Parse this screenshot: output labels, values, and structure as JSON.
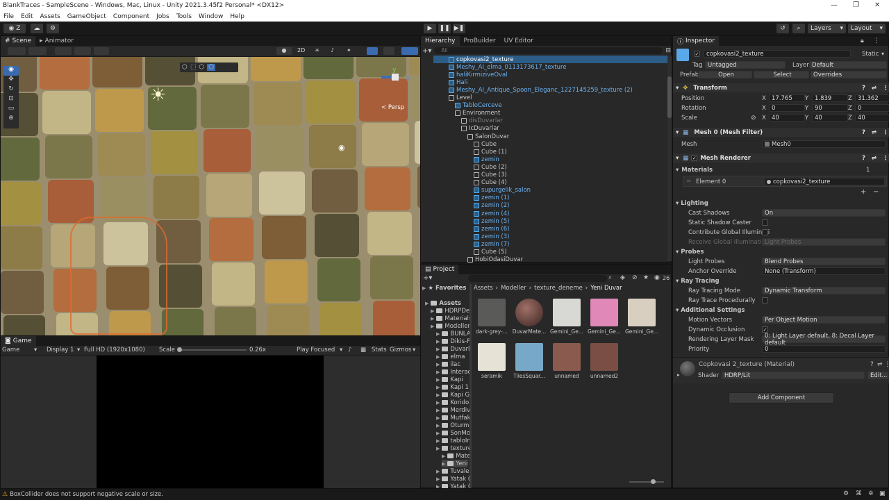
{
  "window": {
    "title": "BlankTraces - SampleScene - Windows, Mac, Linux - Unity 2021.3.45f2 Personal* <DX12>"
  },
  "menu": [
    "File",
    "Edit",
    "Assets",
    "GameObject",
    "Component",
    "Jobs",
    "Tools",
    "Window",
    "Help"
  ],
  "toolbar": {
    "account_label": "Z",
    "layers_label": "Layers",
    "layout_label": "Layout"
  },
  "scene_panel": {
    "tabs": [
      "Scene",
      "Animator"
    ],
    "mode_2d": "2D",
    "persp_label": "< Persp",
    "gizmo_y": "y",
    "gizmo_z": "z"
  },
  "game_panel": {
    "tab": "Game",
    "mode": "Game",
    "display": "Display 1",
    "resolution": "Full HD (1920x1080)",
    "scale_label": "Scale",
    "scale_value": "0.26x",
    "play_focused": "Play Focused",
    "stats": "Stats",
    "gizmos": "Gizmos"
  },
  "hierarchy": {
    "tabs": [
      "Hierarchy",
      "ProBuilder",
      "UV Editor"
    ],
    "search_placeholder": "All",
    "items": [
      {
        "label": "copkovasi2_texture",
        "indent": 0,
        "style": "selected",
        "icon": "blue"
      },
      {
        "label": "Meshy_AI_elma_0113173617_texture",
        "indent": 0,
        "style": "blue",
        "icon": "blue"
      },
      {
        "label": "haliKirmiziveOval",
        "indent": 0,
        "style": "blue",
        "icon": "blue"
      },
      {
        "label": "Hali",
        "indent": 0,
        "style": "blue",
        "icon": "blue"
      },
      {
        "label": "Meshy_AI_Antique_Spoon_Eleganc_1227145259_texture (2)",
        "indent": 0,
        "style": "blue",
        "icon": "blue"
      },
      {
        "label": "Level",
        "indent": 0,
        "style": "normal",
        "icon": "grey"
      },
      {
        "label": "TabloCerceve",
        "indent": 1,
        "style": "blue",
        "icon": "blue"
      },
      {
        "label": "Environment",
        "indent": 1,
        "style": "normal",
        "icon": "grey"
      },
      {
        "label": "disDuvarlar",
        "indent": 2,
        "style": "dim",
        "icon": "grey"
      },
      {
        "label": "IcDuvarlar",
        "indent": 2,
        "style": "normal",
        "icon": "grey"
      },
      {
        "label": "SalonDuvar",
        "indent": 3,
        "style": "normal",
        "icon": "grey"
      },
      {
        "label": "Cube",
        "indent": 4,
        "style": "normal",
        "icon": "grey"
      },
      {
        "label": "Cube (1)",
        "indent": 4,
        "style": "normal",
        "icon": "grey"
      },
      {
        "label": "zemin",
        "indent": 4,
        "style": "blue",
        "icon": "blue"
      },
      {
        "label": "Cube (2)",
        "indent": 4,
        "style": "normal",
        "icon": "grey"
      },
      {
        "label": "Cube (3)",
        "indent": 4,
        "style": "normal",
        "icon": "grey"
      },
      {
        "label": "Cube (4)",
        "indent": 4,
        "style": "normal",
        "icon": "grey"
      },
      {
        "label": "supurgelik_salon",
        "indent": 4,
        "style": "blue",
        "icon": "blue"
      },
      {
        "label": "zemin (1)",
        "indent": 4,
        "style": "blue",
        "icon": "blue"
      },
      {
        "label": "zemin (2)",
        "indent": 4,
        "style": "blue",
        "icon": "blue"
      },
      {
        "label": "zemin (4)",
        "indent": 4,
        "style": "blue",
        "icon": "blue"
      },
      {
        "label": "zemin (5)",
        "indent": 4,
        "style": "blue",
        "icon": "blue"
      },
      {
        "label": "zemin (6)",
        "indent": 4,
        "style": "blue",
        "icon": "blue"
      },
      {
        "label": "zemin (3)",
        "indent": 4,
        "style": "blue",
        "icon": "blue"
      },
      {
        "label": "zemin (7)",
        "indent": 4,
        "style": "blue",
        "icon": "blue"
      },
      {
        "label": "Cube (5)",
        "indent": 4,
        "style": "normal",
        "icon": "grey"
      },
      {
        "label": "HobiOdasiDuvar",
        "indent": 3,
        "style": "normal",
        "icon": "grey"
      }
    ]
  },
  "project": {
    "tab": "Project",
    "count": "26",
    "favorites": "Favorites",
    "breadcrumb": [
      "Assets",
      "Modeller",
      "texture_deneme",
      "Yeni Duvar"
    ],
    "tree": [
      {
        "label": "Assets",
        "indent": 0,
        "bold": true
      },
      {
        "label": "HDRPDef",
        "indent": 1
      },
      {
        "label": "Materials",
        "indent": 1
      },
      {
        "label": "Modeller",
        "indent": 1
      },
      {
        "label": "BUNLA",
        "indent": 2
      },
      {
        "label": "Dikis-F",
        "indent": 2
      },
      {
        "label": "Duvarl",
        "indent": 2
      },
      {
        "label": "elma",
        "indent": 2
      },
      {
        "label": "ilac",
        "indent": 2
      },
      {
        "label": "Interac",
        "indent": 2
      },
      {
        "label": "Kapi",
        "indent": 2
      },
      {
        "label": "Kapi 1",
        "indent": 2
      },
      {
        "label": "Kapi Gi",
        "indent": 2
      },
      {
        "label": "Koridor",
        "indent": 2
      },
      {
        "label": "Merdiv",
        "indent": 2
      },
      {
        "label": "Mutfak",
        "indent": 2
      },
      {
        "label": "Oturma",
        "indent": 2
      },
      {
        "label": "SonMo",
        "indent": 2
      },
      {
        "label": "tabloIm",
        "indent": 2
      },
      {
        "label": "texture",
        "indent": 2
      },
      {
        "label": "Mate",
        "indent": 3
      },
      {
        "label": "Yeni",
        "indent": 3,
        "selected": true
      },
      {
        "label": "Tuvale",
        "indent": 2
      },
      {
        "label": "Yatak (",
        "indent": 2
      },
      {
        "label": "Yatak (",
        "indent": 2
      }
    ],
    "assets": [
      {
        "label": "dark-grey-...",
        "color": "#5a5a58"
      },
      {
        "label": "DuvarMate...",
        "color": "#7a4a44"
      },
      {
        "label": "Gemini_Ge...",
        "color": "#d8d8d4"
      },
      {
        "label": "Gemini_Ge...",
        "color": "#e088b8"
      },
      {
        "label": "Gemini_Ge...",
        "color": "#d8cfc0"
      },
      {
        "label": "seramik",
        "color": "#e6e2d6"
      },
      {
        "label": "TilesSquar...",
        "color": "#78a8c8"
      },
      {
        "label": "unnamed",
        "color": "#8a5a4e"
      },
      {
        "label": "unnamed2",
        "color": "#7a4e44"
      }
    ]
  },
  "inspector": {
    "tab": "Inspector",
    "object_name": "copkovasi2_texture",
    "static_label": "Static",
    "tag_label": "Tag",
    "tag_value": "Untagged",
    "layer_label": "Layer",
    "layer_value": "Default",
    "prefab_label": "Prefab",
    "prefab_open": "Open",
    "prefab_select": "Select",
    "prefab_overrides": "Overrides",
    "transform": {
      "title": "Transform",
      "position_label": "Position",
      "rotation_label": "Rotation",
      "scale_label": "Scale",
      "position": [
        "17.765",
        "1.839",
        "31.362"
      ],
      "rotation": [
        "0",
        "90",
        "0"
      ],
      "scale": [
        "40",
        "40",
        "40"
      ]
    },
    "mesh_filter": {
      "title": "Mesh 0 (Mesh Filter)",
      "mesh_label": "Mesh",
      "mesh_value": "Mesh0"
    },
    "mesh_renderer": {
      "title": "Mesh Renderer",
      "materials_label": "Materials",
      "materials_count": "1",
      "element0_label": "Element 0",
      "element0_value": "copkovasi2_texture",
      "lighting": "Lighting",
      "cast_shadows_label": "Cast Shadows",
      "cast_shadows_value": "On",
      "static_shadow_label": "Static Shadow Caster",
      "contribute_gi_label": "Contribute Global Illuminati",
      "receive_gi_label": "Receive Global Illumination",
      "receive_gi_value": "Light Probes",
      "probes": "Probes",
      "light_probes_label": "Light Probes",
      "light_probes_value": "Blend Probes",
      "anchor_label": "Anchor Override",
      "anchor_value": "None (Transform)",
      "ray_tracing": "Ray Tracing",
      "rt_mode_label": "Ray Tracing Mode",
      "rt_mode_value": "Dynamic Transform",
      "rt_proc_label": "Ray Trace Procedurally",
      "additional": "Additional Settings",
      "motion_label": "Motion Vectors",
      "motion_value": "Per Object Motion",
      "occlusion_label": "Dynamic Occlusion",
      "rlm_label": "Rendering Layer Mask",
      "rlm_value": "0: Light Layer default, 8: Decal Layer default",
      "priority_label": "Priority",
      "priority_value": "0"
    },
    "material": {
      "title": "Copkovasi 2_texture (Material)",
      "shader_label": "Shader",
      "shader_value": "HDRP/Lit",
      "edit": "Edit..."
    },
    "add_component": "Add Component"
  },
  "status": {
    "message": "BoxCollider does not support negative scale or size."
  }
}
